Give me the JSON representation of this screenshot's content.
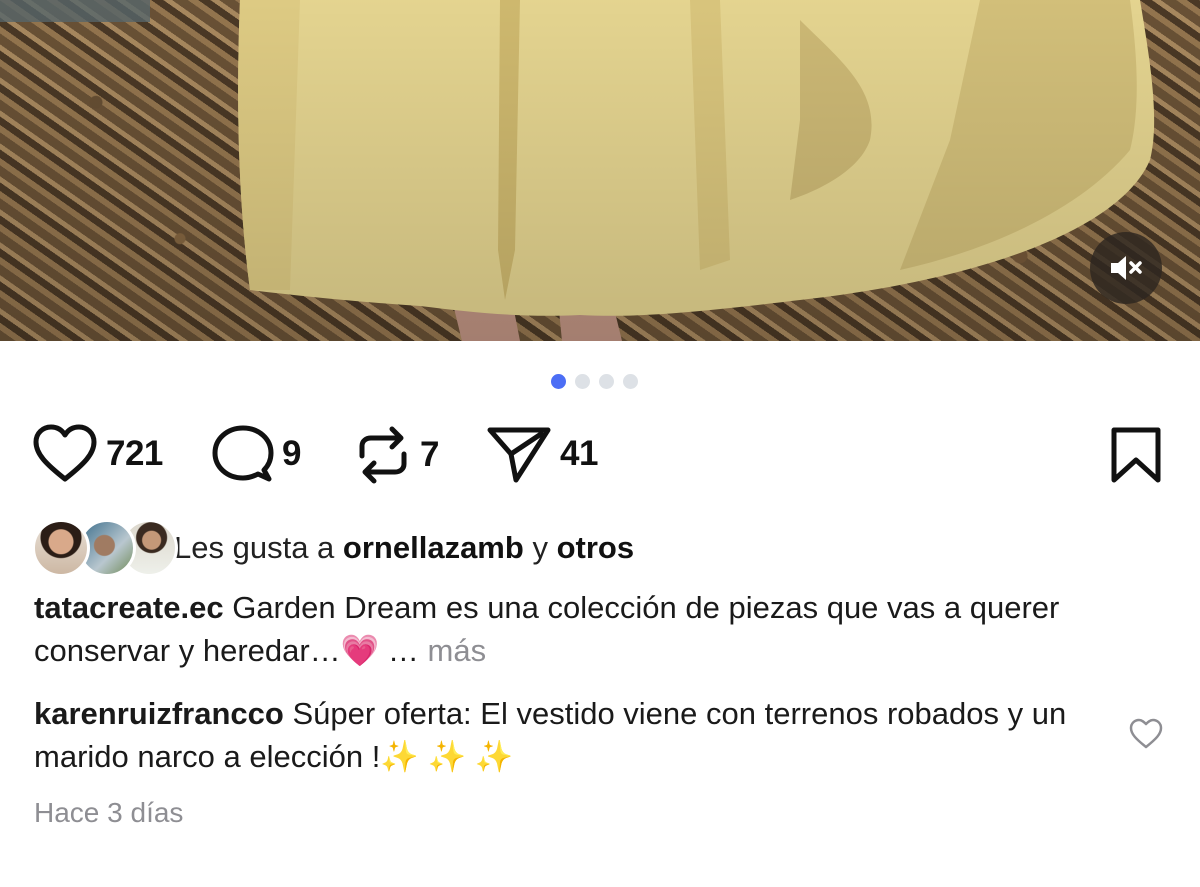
{
  "post": {
    "media": {
      "image_desc_icon": "photo",
      "sound_state": "muted",
      "mute_icon": "speaker-muted-icon"
    },
    "carousel": {
      "count": 4,
      "active_index": 0,
      "active_color": "#4c6ef5",
      "inactive_color": "#dde1e6"
    },
    "actions": {
      "likes": "721",
      "comments": "9",
      "reposts": "7",
      "shares": "41"
    },
    "liked_by": {
      "prefix": "Les gusta a",
      "user": "ornellazamb",
      "conjunction": "y",
      "others": "otros"
    },
    "caption": {
      "username": "tatacreate.ec",
      "text": "Garden Dream es una colección de piezas que vas a querer conservar y heredar…💗 …",
      "more_label": "más"
    },
    "comment": {
      "username": "karenruizfrancco",
      "text": "Súper oferta: El vestido viene con terrenos robados y un marido narco a elección !✨ ✨ ✨"
    },
    "timestamp": "Hace 3 días"
  }
}
